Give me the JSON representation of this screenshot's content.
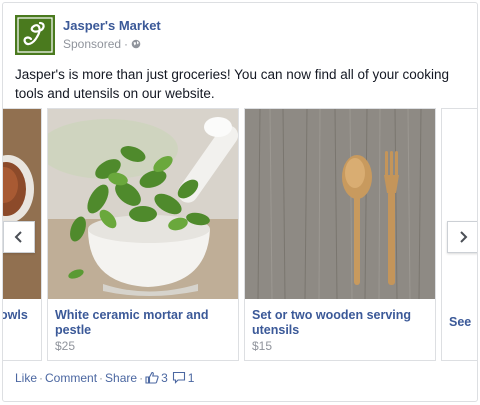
{
  "post": {
    "page_name": "Jasper's Market",
    "sponsored": "Sponsored",
    "text": "Jasper's is more than just groceries! You can now find all of your cooking tools and utensils on our website."
  },
  "carousel": {
    "items": [
      {
        "title": "owls",
        "price": ""
      },
      {
        "title": "White ceramic mortar and pestle",
        "price": "$25"
      },
      {
        "title": "Set or two wooden serving utensils",
        "price": "$15"
      },
      {
        "title": "See",
        "price": ""
      }
    ]
  },
  "footer": {
    "like": "Like",
    "comment": "Comment",
    "share": "Share",
    "like_count": "3",
    "comment_count": "1"
  },
  "icons": [
    "logo-script-j",
    "globe-icon",
    "chevron-left-icon",
    "chevron-right-icon",
    "thumbs-up-icon",
    "comment-icon"
  ],
  "colors": {
    "brand": "#3b5998",
    "logo_bg": "#4a7a1e",
    "muted": "#90949c"
  }
}
